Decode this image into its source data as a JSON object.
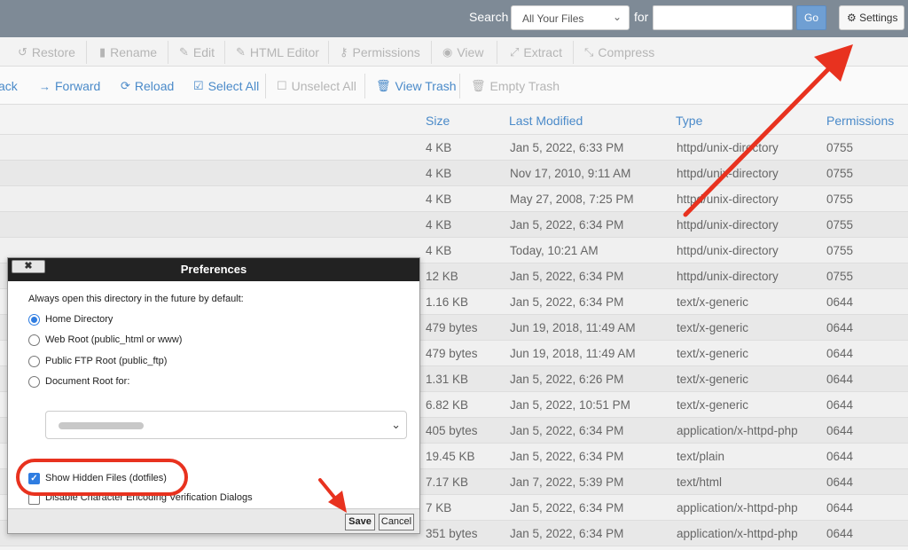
{
  "search": {
    "label": "Search",
    "scope_selected": "All Your Files",
    "for_label": "for",
    "query_value": "",
    "go_label": "Go",
    "settings_label": "Settings"
  },
  "toolbar1": {
    "restore": "Restore",
    "rename": "Rename",
    "edit": "Edit",
    "html_editor": "HTML Editor",
    "permissions": "Permissions",
    "view": "View",
    "extract": "Extract",
    "compress": "Compress"
  },
  "toolbar2": {
    "back": "ack",
    "forward": "Forward",
    "reload": "Reload",
    "select_all": "Select All",
    "unselect_all": "Unselect All",
    "view_trash": "View Trash",
    "empty_trash": "Empty Trash"
  },
  "table": {
    "headers": {
      "size": "Size",
      "last_modified": "Last Modified",
      "type": "Type",
      "permissions": "Permissions"
    },
    "rows": [
      {
        "size": "4 KB",
        "modified": "Jan 5, 2022, 6:33 PM",
        "type": "httpd/unix-directory",
        "perm": "0755"
      },
      {
        "size": "4 KB",
        "modified": "Nov 17, 2010, 9:11 AM",
        "type": "httpd/unix-directory",
        "perm": "0755"
      },
      {
        "size": "4 KB",
        "modified": "May 27, 2008, 7:25 PM",
        "type": "httpd/unix-directory",
        "perm": "0755"
      },
      {
        "size": "4 KB",
        "modified": "Jan 5, 2022, 6:34 PM",
        "type": "httpd/unix-directory",
        "perm": "0755"
      },
      {
        "size": "4 KB",
        "modified": "Today, 10:21 AM",
        "type": "httpd/unix-directory",
        "perm": "0755"
      },
      {
        "size": "12 KB",
        "modified": "Jan 5, 2022, 6:34 PM",
        "type": "httpd/unix-directory",
        "perm": "0755"
      },
      {
        "size": "1.16 KB",
        "modified": "Jan 5, 2022, 6:34 PM",
        "type": "text/x-generic",
        "perm": "0644"
      },
      {
        "size": "479 bytes",
        "modified": "Jun 19, 2018, 11:49 AM",
        "type": "text/x-generic",
        "perm": "0644"
      },
      {
        "size": "479 bytes",
        "modified": "Jun 19, 2018, 11:49 AM",
        "type": "text/x-generic",
        "perm": "0644"
      },
      {
        "size": "1.31 KB",
        "modified": "Jan 5, 2022, 6:26 PM",
        "type": "text/x-generic",
        "perm": "0644"
      },
      {
        "size": "6.82 KB",
        "modified": "Jan 5, 2022, 10:51 PM",
        "type": "text/x-generic",
        "perm": "0644"
      },
      {
        "size": "405 bytes",
        "modified": "Jan 5, 2022, 6:34 PM",
        "type": "application/x-httpd-php",
        "perm": "0644"
      },
      {
        "size": "19.45 KB",
        "modified": "Jan 5, 2022, 6:34 PM",
        "type": "text/plain",
        "perm": "0644"
      },
      {
        "size": "7.17 KB",
        "modified": "Jan 7, 2022, 5:39 PM",
        "type": "text/html",
        "perm": "0644"
      },
      {
        "size": "7 KB",
        "modified": "Jan 5, 2022, 6:34 PM",
        "type": "application/x-httpd-php",
        "perm": "0644"
      },
      {
        "size": "351 bytes",
        "modified": "Jan 5, 2022, 6:34 PM",
        "type": "application/x-httpd-php",
        "perm": "0644"
      }
    ]
  },
  "dialog": {
    "title": "Preferences",
    "close_label": "✖",
    "intro": "Always open this directory in the future by default:",
    "opt_home": "Home Directory",
    "opt_webroot": "Web Root (public_html or www)",
    "opt_ftp": "Public FTP Root (public_ftp)",
    "opt_docroot": "Document Root for:",
    "selected_option": "Home Directory",
    "show_hidden": "Show Hidden Files (dotfiles)",
    "show_hidden_checked": true,
    "disable_encoding": "Disable Character Encoding Verification Dialogs",
    "disable_encoding_checked": false,
    "save": "Save",
    "cancel": "Cancel"
  },
  "colors": {
    "topbar": "#7e8a96",
    "link_blue": "#4a8ac9",
    "annotation_red": "#e8321f",
    "checkbox_blue": "#2f7de1"
  }
}
